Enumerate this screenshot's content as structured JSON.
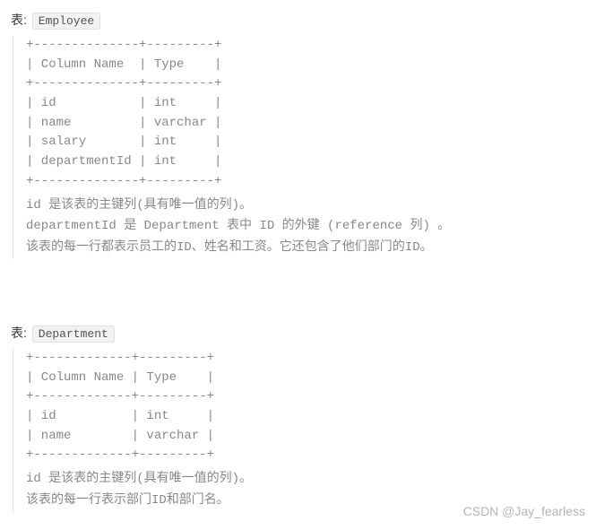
{
  "table1": {
    "label_prefix": "表:",
    "name": "Employee",
    "ascii": "+--------------+---------+\n| Column Name  | Type    |\n+--------------+---------+\n| id           | int     |\n| name         | varchar |\n| salary       | int     |\n| departmentId | int     |\n+--------------+---------+",
    "desc_line1": "id 是该表的主键列(具有唯一值的列)。",
    "desc_line2": "departmentId 是 Department 表中 ID 的外键 (reference 列) 。",
    "desc_line3": "该表的每一行都表示员工的ID、姓名和工资。它还包含了他们部门的ID。"
  },
  "table2": {
    "label_prefix": "表:",
    "name": "Department",
    "ascii": "+-------------+---------+\n| Column Name | Type    |\n+-------------+---------+\n| id          | int     |\n| name        | varchar |\n+-------------+---------+",
    "desc_line1": "id 是该表的主键列(具有唯一值的列)。",
    "desc_line2": "该表的每一行表示部门ID和部门名。"
  },
  "watermark": "CSDN @Jay_fearless"
}
